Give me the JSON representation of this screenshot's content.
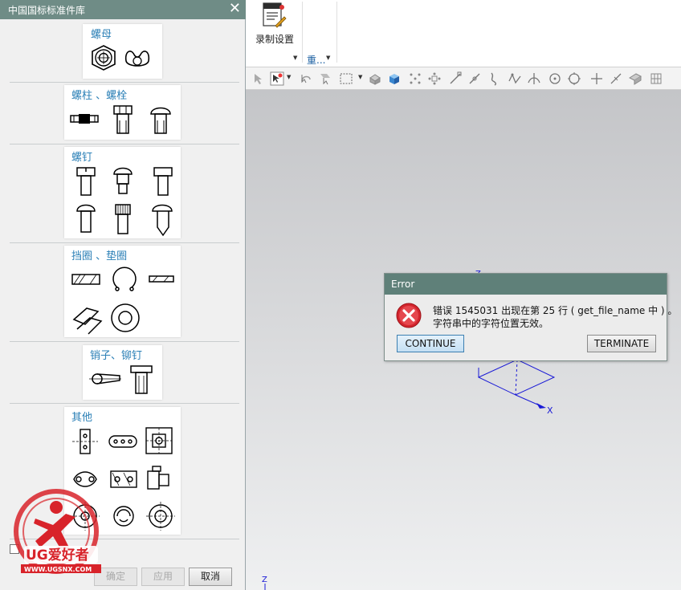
{
  "panel": {
    "title": "中国国标标准件库",
    "categories": [
      {
        "label": "螺母"
      },
      {
        "label": "螺柱 、螺栓"
      },
      {
        "label": "螺钉"
      },
      {
        "label": "挡圈 、垫圈"
      },
      {
        "label": "销子、铆钉"
      },
      {
        "label": "其他"
      }
    ],
    "ok_label": "确定",
    "apply_label": "应用",
    "cancel_label": "取消"
  },
  "ribbon": {
    "record_settings_label": "录制设置",
    "group_label": "重..."
  },
  "error_dialog": {
    "title": "Error",
    "message_line1": "错误 1545031 出现在第 25 行 ( get_file_name 中 ) 。",
    "message_line2": "字符串中的字符位置无效。",
    "continue_label": "CONTINUE",
    "terminate_label": "TERMINATE"
  },
  "viewport": {
    "axis_x": "X",
    "axis_z": "Z",
    "axis_z_origin": "Z"
  },
  "watermark": {
    "brand": "UG爱好者",
    "url": "WWW.UGSNX.COM"
  },
  "colors": {
    "title_bar": "#6f8c86",
    "dialog_title": "#5f8079",
    "category_text": "#2a7fb6",
    "axis_blue": "#1a1ad6",
    "error_red": "#d3262e",
    "watermark_red": "#d8232a"
  }
}
